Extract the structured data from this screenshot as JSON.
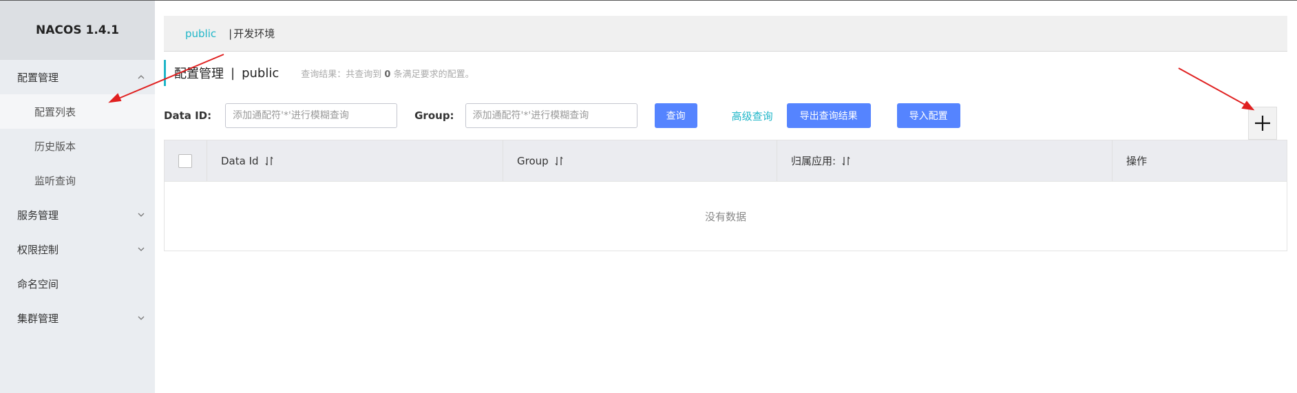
{
  "sidebar": {
    "logo": "NACOS 1.4.1",
    "items": [
      {
        "label": "配置管理",
        "expanded": true
      },
      {
        "label": "配置列表"
      },
      {
        "label": "历史版本"
      },
      {
        "label": "监听查询"
      },
      {
        "label": "服务管理",
        "expanded": false
      },
      {
        "label": "权限控制",
        "expanded": false
      },
      {
        "label": "命名空间"
      },
      {
        "label": "集群管理",
        "expanded": false
      }
    ]
  },
  "namespace_bar": {
    "active": "public",
    "separator": "|",
    "other": "开发环境"
  },
  "title": {
    "section": "配置管理",
    "separator": "|",
    "namespace": "public",
    "summary_prefix": "查询结果：共查询到",
    "summary_count": "0",
    "summary_suffix": "条满足要求的配置。"
  },
  "search": {
    "data_id_label": "Data ID:",
    "data_id_placeholder": "添加通配符'*'进行模糊查询",
    "group_label": "Group:",
    "group_placeholder": "添加通配符'*'进行模糊查询",
    "query_button": "查询",
    "advanced_link": "高级查询",
    "export_button": "导出查询结果",
    "import_button": "导入配置"
  },
  "table": {
    "columns": [
      "Data Id",
      "Group",
      "归属应用:",
      "操作"
    ],
    "empty_text": "没有数据"
  },
  "colors": {
    "accent": "#1fb6c8",
    "primary_button": "#5584ff",
    "sidebar_bg": "#eaedf1",
    "annotation_arrow": "#e02020"
  },
  "icons": {
    "add": "plus-icon",
    "sort": "sort-icon",
    "chevron_up": "chevron-up-icon",
    "chevron_down": "chevron-down-icon"
  }
}
